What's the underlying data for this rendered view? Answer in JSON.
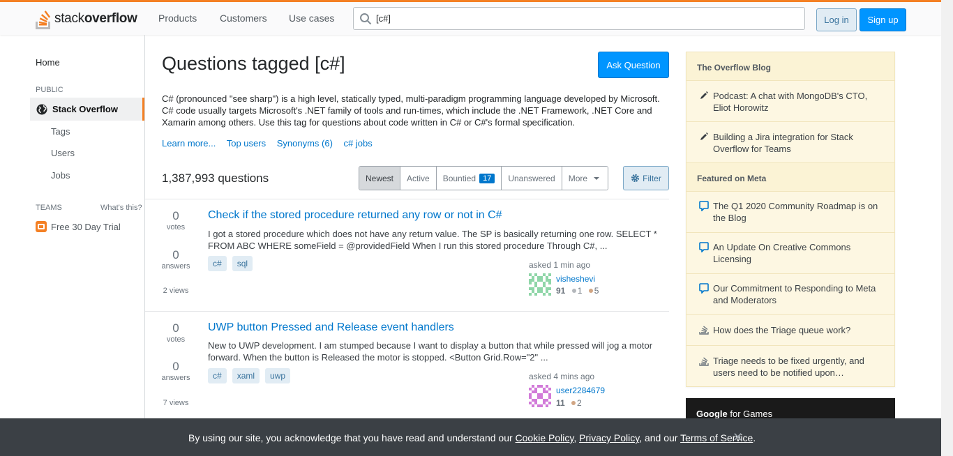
{
  "header": {
    "logo_text_light": "stack",
    "logo_text_bold": "overflow",
    "nav": [
      "Products",
      "Customers",
      "Use cases"
    ],
    "search_value": "[c#]",
    "login_label": "Log in",
    "signup_label": "Sign up",
    "accent_color": "#f48024"
  },
  "leftnav": {
    "home": "Home",
    "public_label": "PUBLIC",
    "stack_overflow": "Stack Overflow",
    "tags": "Tags",
    "users": "Users",
    "jobs": "Jobs",
    "teams_label": "TEAMS",
    "whats_this": "What's this?",
    "trial": "Free 30 Day Trial"
  },
  "main": {
    "title": "Questions tagged [c#]",
    "ask_label": "Ask Question",
    "description": "C# (pronounced \"see sharp\") is a high level, statically typed, multi-paradigm programming language developed by Microsoft. C# code usually targets Microsoft's .NET family of tools and run-times, which include the .NET Framework, .NET Core and Xamarin among others. Use this tag for questions about code written in C# or C#'s formal specification.",
    "links": {
      "learn_more": "Learn more...",
      "top_users": "Top users",
      "synonyms": "Synonyms (6)",
      "jobs": "c# jobs"
    },
    "question_count": "1,387,993 questions",
    "filters": {
      "newest": "Newest",
      "active": "Active",
      "bountied": "Bountied",
      "bountied_count": "17",
      "unanswered": "Unanswered",
      "more": "More"
    },
    "filter_button": "Filter"
  },
  "questions": [
    {
      "votes": "0",
      "votes_label": "votes",
      "answers": "0",
      "answers_label": "answers",
      "views": "2 views",
      "title": "Check if the stored procedure returned any row or not in C#",
      "excerpt": "I got a stored procedure which does not have any return value. The SP is basically returning one row. SELECT * FROM ABC WHERE someField = @providedField When I run this stored procedure Through C#, ...",
      "tags": [
        "c#",
        "sql"
      ],
      "asked": "asked 1 min ago",
      "user": "visheshevi",
      "rep": "91",
      "silver": "1",
      "bronze": "5"
    },
    {
      "votes": "0",
      "votes_label": "votes",
      "answers": "0",
      "answers_label": "answers",
      "views": "7 views",
      "title": "UWP button Pressed and Release event handlers",
      "excerpt": "New to UWP development. I am stumped because I want to display a button that while pressed will jog a motor forward. When the button is Released the motor is stopped. <Button Grid.Row=\"2\" ...",
      "tags": [
        "c#",
        "xaml",
        "uwp"
      ],
      "asked": "asked 4 mins ago",
      "user": "user2284679",
      "rep": "11",
      "bronze": "2"
    }
  ],
  "sidebar": {
    "blog_header": "The Overflow Blog",
    "blog_items": [
      "Podcast: A chat with MongoDB's CTO, Eliot Horowitz",
      "Building a Jira integration for Stack Overflow for Teams"
    ],
    "meta_header": "Featured on Meta",
    "meta_items": [
      "The Q1 2020 Community Roadmap is on the Blog",
      "An Update On Creative Commons Licensing",
      "Our Commitment to Responding to Meta and Moderators",
      "How does the Triage queue work?",
      "Triage needs to be fixed urgently, and users need to be notified upon…"
    ],
    "ad_bold": "Google",
    "ad_rest": " for Games"
  },
  "cookie": {
    "prefix": "By using our site, you acknowledge that you have read and understand our ",
    "cookie_policy": "Cookie Policy",
    "sep1": ", ",
    "privacy_policy": "Privacy Policy",
    "sep2": ", and our ",
    "terms": "Terms of Service",
    "suffix": ".",
    "close": "✕"
  }
}
